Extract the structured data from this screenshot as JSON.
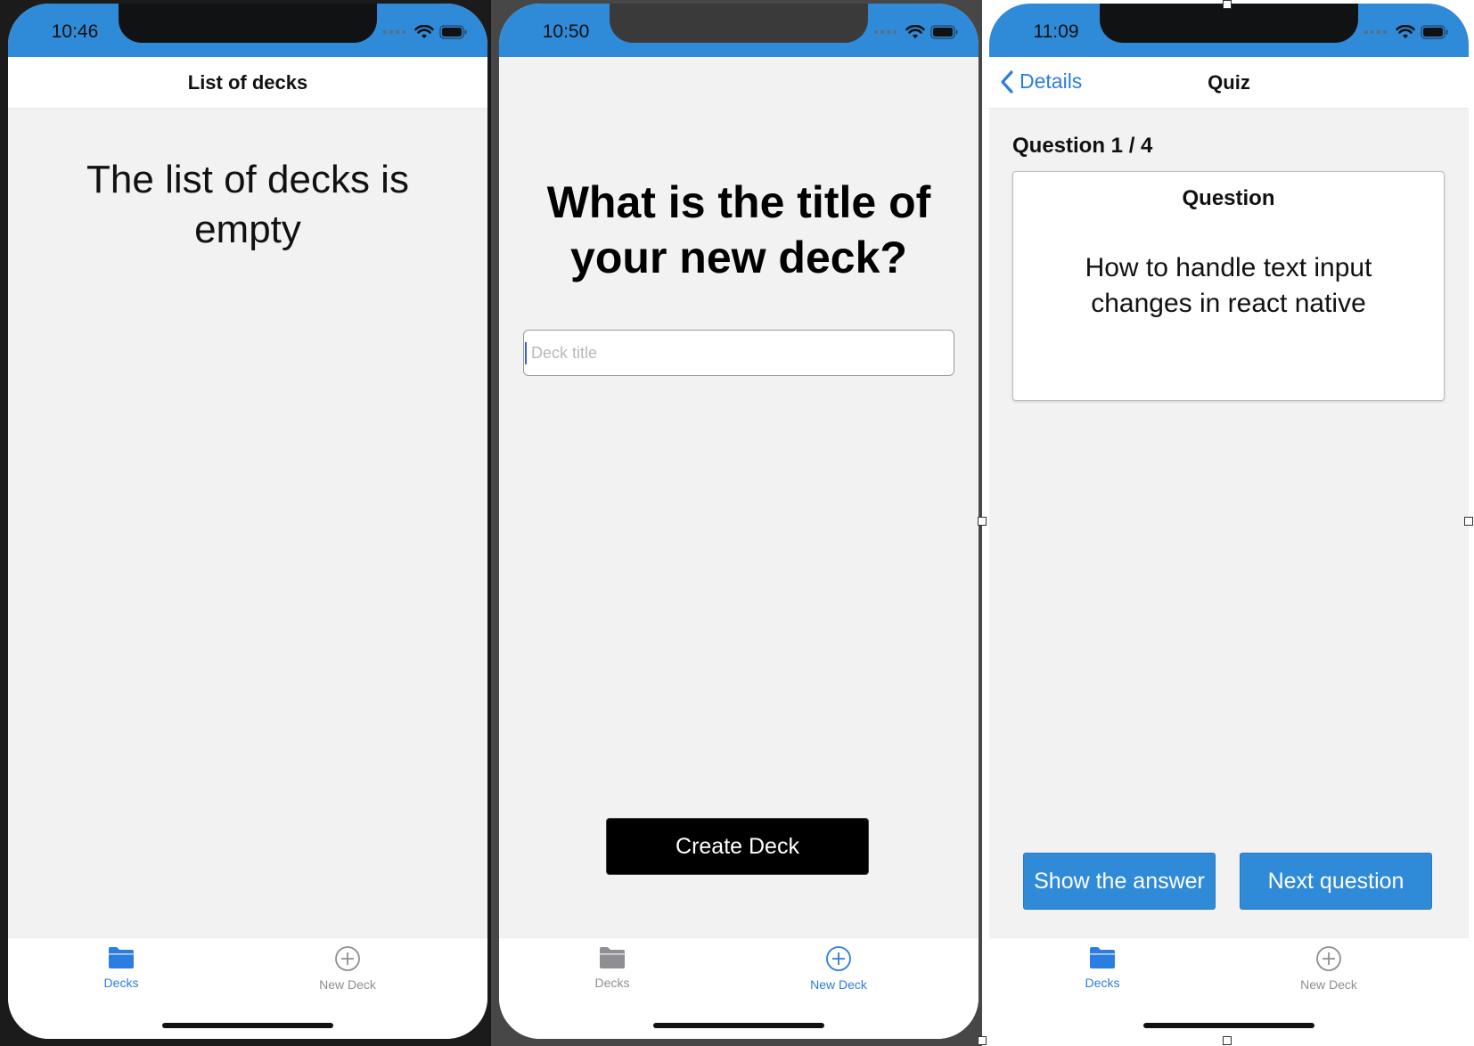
{
  "screens": [
    {
      "time": "10:46",
      "header_title": "List of decks",
      "empty_message": "The list of decks is empty",
      "tabs": [
        {
          "label": "Decks",
          "icon": "folder-icon",
          "active": true
        },
        {
          "label": "New Deck",
          "icon": "plus-circle-icon",
          "active": false
        }
      ]
    },
    {
      "time": "10:50",
      "prompt": "What is the title of your new deck?",
      "input_placeholder": "Deck title",
      "input_value": "",
      "create_button": "Create Deck",
      "tabs": [
        {
          "label": "Decks",
          "icon": "folder-icon",
          "active": false
        },
        {
          "label": "New Deck",
          "icon": "plus-circle-icon",
          "active": true
        }
      ]
    },
    {
      "time": "11:09",
      "back_label": "Details",
      "header_title": "Quiz",
      "question_counter": "Question 1 / 4",
      "card_heading": "Question",
      "card_text": "How to handle text input changes in react native",
      "show_answer_button": "Show the answer",
      "next_question_button": "Next question",
      "tabs": [
        {
          "label": "Decks",
          "icon": "folder-icon",
          "active": true
        },
        {
          "label": "New Deck",
          "icon": "plus-circle-icon",
          "active": false
        }
      ]
    }
  ],
  "colors": {
    "accent": "#2b7de0",
    "status_bar": "#2f8ad8",
    "screen_bg": "#f2f2f2",
    "inactive_tab": "#8e8e93"
  }
}
